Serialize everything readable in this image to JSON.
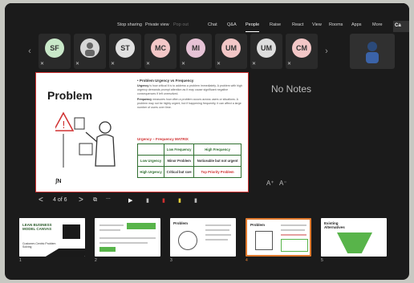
{
  "toolbar": {
    "stop_sharing": "Stop sharing",
    "private_view": "Private view",
    "pop_out": "Pop out",
    "chat": "Chat",
    "qa": "Q&A",
    "people": "People",
    "raise": "Raise",
    "react": "React",
    "view": "View",
    "rooms": "Rooms",
    "apps": "Apps",
    "more": "More",
    "ca": "Ca"
  },
  "participants": [
    {
      "initials": "SF",
      "color": "#c9e8c9"
    },
    {
      "initials": "",
      "color": "#d7d7d7"
    },
    {
      "initials": "ST",
      "color": "#e1e1e1"
    },
    {
      "initials": "MC",
      "color": "#f3c7c7"
    },
    {
      "initials": "MI",
      "color": "#e6c3d6"
    },
    {
      "initials": "UM",
      "color": "#f3c7c7"
    },
    {
      "initials": "UM",
      "color": "#dedede"
    },
    {
      "initials": "CM",
      "color": "#f3c7c7"
    }
  ],
  "slide": {
    "title": "Problem",
    "logo": "ʃN",
    "heading": "Problem Urgency vs Frequency",
    "urgency_label": "Urgency",
    "urgency_text": "is how critical it is to address a problem immediately. A problem with high urgency demands prompt attention as it may cause significant negative consequences if left unresolved.",
    "frequency_label": "Frequency",
    "frequency_text": "measures how often a problem occurs across users or situations. A problem may not be highly urgent, but if happening frequently, it can affect a large number of users over time.",
    "matrix_title": "Urgency – Frequency MATRIX",
    "matrix": {
      "col_low": "Low Frequency",
      "col_high": "High Frequency",
      "row_low": "Low Urgency",
      "row_high": "High Urgency",
      "ll": "Minor Problem",
      "lh": "Noticeable but not urgent",
      "hl": "Critical but rare",
      "hh": "Top Priority Problem"
    }
  },
  "notes": {
    "empty_text": "No Notes",
    "font_up": "A⁺",
    "font_down": "A⁻"
  },
  "controls": {
    "prev": "<",
    "page": "4 of 6",
    "next": ">",
    "more": "..."
  },
  "thumbnails": [
    {
      "num": "1",
      "title": "LEAN BUSINESS MODEL CANVAS",
      "subtitle": "Customer-Centric Problem Solving"
    },
    {
      "num": "2",
      "title": ""
    },
    {
      "num": "3",
      "title": "Problem"
    },
    {
      "num": "4",
      "title": "Problem"
    },
    {
      "num": "5",
      "title": "Existing Alternatives"
    }
  ],
  "colors": {
    "accent": "#e07a2e",
    "slide_border": "#d03030",
    "matrix_green": "#2f6f2f"
  }
}
